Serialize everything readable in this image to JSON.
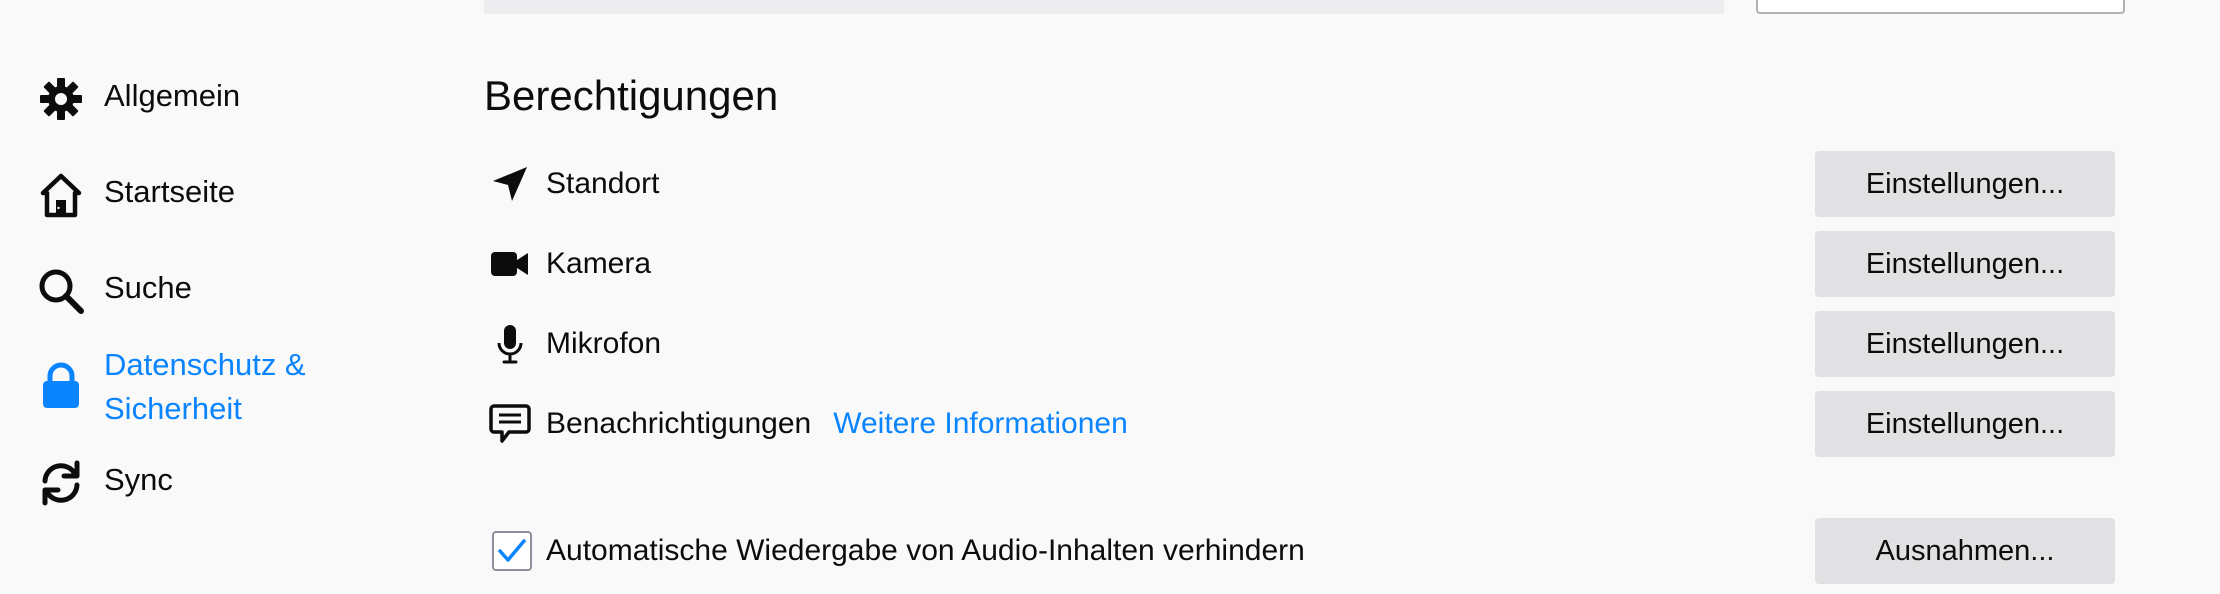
{
  "sidebar": {
    "items": [
      {
        "label": "Allgemein",
        "icon": "gear-icon"
      },
      {
        "label": "Startseite",
        "icon": "home-icon"
      },
      {
        "label": "Suche",
        "icon": "search-icon"
      },
      {
        "label": "Datenschutz &\nSicherheit",
        "icon": "lock-icon",
        "active": true
      },
      {
        "label": "Sync",
        "icon": "sync-icon"
      }
    ],
    "active_color": "#0a84ff"
  },
  "permissions": {
    "title": "Berechtigungen",
    "rows": [
      {
        "label": "Standort",
        "icon": "location-arrow-icon",
        "button": "Einstellungen..."
      },
      {
        "label": "Kamera",
        "icon": "camera-icon",
        "button": "Einstellungen..."
      },
      {
        "label": "Mikrofon",
        "icon": "microphone-icon",
        "button": "Einstellungen..."
      },
      {
        "label": "Benachrichtigungen",
        "icon": "notification-bubble-icon",
        "link": "Weitere Informationen",
        "button": "Einstellungen..."
      }
    ],
    "autoplay": {
      "label": "Automatische Wiedergabe von Audio-Inhalten verhindern",
      "checked": true,
      "button": "Ausnahmen..."
    }
  }
}
